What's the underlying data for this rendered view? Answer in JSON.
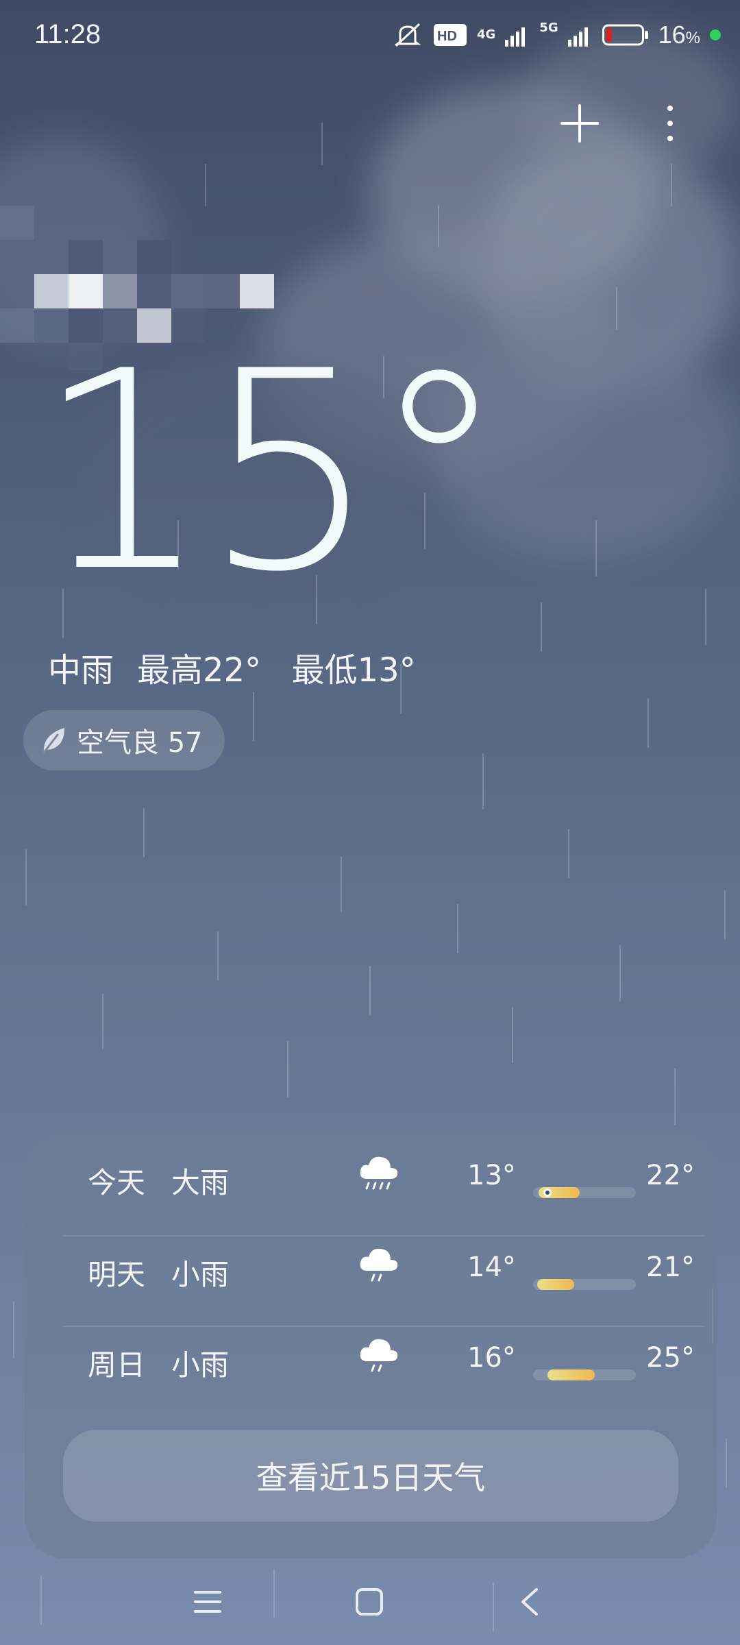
{
  "status_bar": {
    "time": "11:28",
    "network_1": "4G",
    "network_2": "5G",
    "hd_label": "HD",
    "battery_percent": "16",
    "battery_unit": "%",
    "battery_level": 0.16
  },
  "current": {
    "temperature": "15°",
    "condition": "中雨",
    "high": "最高22°",
    "low": "最低13°",
    "aqi": "空气良 57"
  },
  "forecast": [
    {
      "day": "今天",
      "condition": "大雨",
      "low": "13°",
      "high": "22°",
      "icon": "heavy-rain-icon",
      "range_start": 0.05,
      "range_end": 0.45,
      "current_marker": 0.14
    },
    {
      "day": "明天",
      "condition": "小雨",
      "low": "14°",
      "high": "21°",
      "icon": "light-rain-icon",
      "range_start": 0.04,
      "range_end": 0.4
    },
    {
      "day": "周日",
      "condition": "小雨",
      "low": "16°",
      "high": "25°",
      "icon": "light-rain-icon",
      "range_start": 0.14,
      "range_end": 0.6
    }
  ],
  "forecast_button": "查看近15日天气",
  "colors": {
    "accent_bar_start": "#e9e08a",
    "accent_bar_end": "#f0b850",
    "battery_low": "#e0201c",
    "dot_green": "#2fd15a"
  }
}
